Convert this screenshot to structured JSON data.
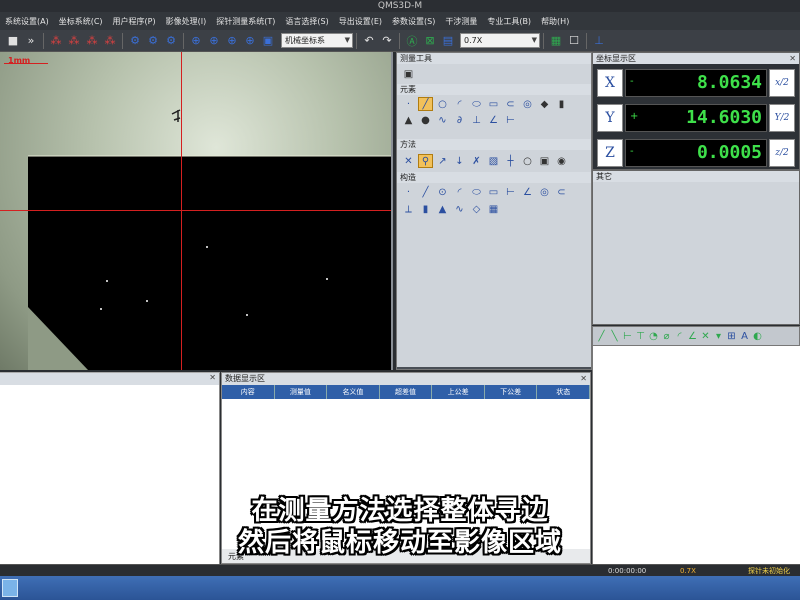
{
  "window": {
    "title": "QMS3D-M"
  },
  "menu": [
    "系统设置(A)",
    "坐标系统(C)",
    "用户程序(P)",
    "影像处理(I)",
    "探针测量系统(T)",
    "语言选择(S)",
    "导出设置(E)",
    "参数设置(S)",
    "干涉测量",
    "专业工具(B)",
    "帮助(H)"
  ],
  "toolbar": {
    "coord_system": "机械坐标系",
    "zoom": "0.7X"
  },
  "viewport": {
    "scale_label": "1mm"
  },
  "tool_panel": {
    "title": "测量工具",
    "element_label": "元素",
    "method_label": "方法",
    "construct_label": "构造"
  },
  "coordinates": {
    "panel_title": "坐标显示区",
    "other_title": "其它",
    "axes": [
      {
        "name": "X",
        "sign": "-",
        "value": "8.0634",
        "half": "x/2"
      },
      {
        "name": "Y",
        "sign": "+",
        "value": "14.6030",
        "half": "Y/2"
      },
      {
        "name": "Z",
        "sign": "-",
        "value": "0.0005",
        "half": "z/2"
      }
    ]
  },
  "data_panel": {
    "title": "数据显示区",
    "columns": [
      "内容",
      "测量值",
      "名义值",
      "超差值",
      "上公差",
      "下公差",
      "状态"
    ],
    "tab_element": "元素"
  },
  "status": {
    "time": "0:00:00:00",
    "zoom": "0.7X",
    "probe": "探针未初始化"
  },
  "subtitles": {
    "line1": "在测量方法选择整体寻边",
    "line2": "然后将鼠标移动至影像区域"
  },
  "colors": {
    "value_green": "#3ee04a",
    "crosshair_red": "#d42020",
    "table_header_blue": "#2f5fa8"
  }
}
